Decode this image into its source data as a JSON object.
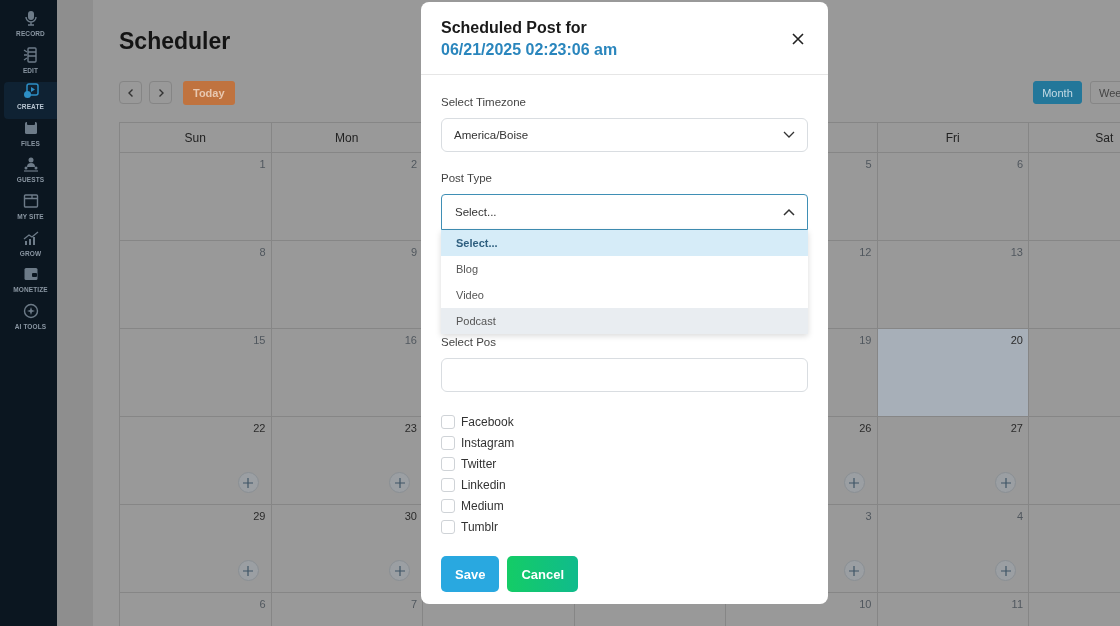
{
  "sidebar": {
    "items": [
      {
        "label": "RECORD",
        "kind": "mic",
        "selected": false
      },
      {
        "label": "EDIT",
        "kind": "film",
        "selected": false
      },
      {
        "label": "CREATE",
        "kind": "play",
        "selected": true
      },
      {
        "label": "FILES",
        "kind": "folder",
        "selected": false
      },
      {
        "label": "GUESTS",
        "kind": "people",
        "selected": false
      },
      {
        "label": "MY SITE",
        "kind": "window",
        "selected": false
      },
      {
        "label": "GROW",
        "kind": "bars",
        "selected": false
      },
      {
        "label": "MONETIZE",
        "kind": "wallet",
        "selected": false
      },
      {
        "label": "AI TOOLS",
        "kind": "ai",
        "selected": false
      }
    ]
  },
  "page": {
    "title": "Scheduler"
  },
  "toolbar": {
    "today": "Today",
    "views": [
      {
        "label": "Month",
        "selected": true
      },
      {
        "label": "Wee",
        "selected": false
      }
    ]
  },
  "calendar": {
    "headers": {
      "sun": "Sun",
      "mon": "Mon",
      "fri": "Fri",
      "sat": "Sat"
    },
    "weeks": [
      {
        "sun": {
          "day": "1",
          "faded": true,
          "today": false,
          "add": false
        },
        "mon": {
          "day": "2",
          "faded": true,
          "today": false,
          "add": false
        },
        "thu": {
          "day": "5",
          "faded": true,
          "today": false,
          "add": false
        },
        "fri": {
          "day": "6",
          "faded": true,
          "today": false,
          "add": false
        }
      },
      {
        "sun": {
          "day": "8",
          "faded": true,
          "today": false,
          "add": false
        },
        "mon": {
          "day": "9",
          "faded": true,
          "today": false,
          "add": false
        },
        "thu": {
          "day": "12",
          "faded": true,
          "today": false,
          "add": false
        },
        "fri": {
          "day": "13",
          "faded": true,
          "today": false,
          "add": false
        }
      },
      {
        "sun": {
          "day": "15",
          "faded": true,
          "today": false,
          "add": false
        },
        "mon": {
          "day": "16",
          "faded": true,
          "today": false,
          "add": false
        },
        "thu": {
          "day": "19",
          "faded": true,
          "today": false,
          "add": false
        },
        "fri": {
          "day": "20",
          "faded": false,
          "today": true,
          "add": false
        }
      },
      {
        "sun": {
          "day": "22",
          "faded": false,
          "today": false,
          "add": true
        },
        "mon": {
          "day": "23",
          "faded": false,
          "today": false,
          "add": true
        },
        "thu": {
          "day": "26",
          "faded": false,
          "today": false,
          "add": true
        },
        "fri": {
          "day": "27",
          "faded": false,
          "today": false,
          "add": true
        }
      },
      {
        "sun": {
          "day": "29",
          "faded": false,
          "today": false,
          "add": true
        },
        "mon": {
          "day": "30",
          "faded": false,
          "today": false,
          "add": true
        },
        "thu": {
          "day": "3",
          "faded": true,
          "today": false,
          "add": true
        },
        "fri": {
          "day": "4",
          "faded": true,
          "today": false,
          "add": true
        }
      },
      {
        "sun": {
          "day": "6",
          "faded": true,
          "today": false,
          "add": false
        },
        "mon": {
          "day": "7",
          "faded": true,
          "today": false,
          "add": false
        },
        "thu": {
          "day": "10",
          "faded": true,
          "today": false,
          "add": false
        },
        "fri": {
          "day": "11",
          "faded": true,
          "today": false,
          "add": false
        }
      }
    ]
  },
  "modal": {
    "title": "Scheduled Post for",
    "datetime": "06/21/2025 02:23:06 am",
    "fields": [
      {
        "kind": "select",
        "label": "Select Timezone",
        "value": "America/Boise",
        "open": false
      },
      {
        "kind": "select",
        "label": "Post Type",
        "placeholder": "Select...",
        "open": true,
        "options": [
          {
            "label": "Select...",
            "selected": true,
            "hovered": false
          },
          {
            "label": "Blog",
            "selected": false,
            "hovered": false
          },
          {
            "label": "Video",
            "selected": false,
            "hovered": false
          },
          {
            "label": "Podcast",
            "selected": false,
            "hovered": true
          }
        ]
      },
      {
        "kind": "text",
        "label": "Select Pos"
      }
    ],
    "checkboxes": [
      {
        "label": "Facebook",
        "checked": false
      },
      {
        "label": "Instagram",
        "checked": false
      },
      {
        "label": "Twitter",
        "checked": false
      },
      {
        "label": "Linkedin",
        "checked": false
      },
      {
        "label": "Medium",
        "checked": false
      },
      {
        "label": "Tumblr",
        "checked": false
      }
    ],
    "buttons": [
      {
        "label": "Save",
        "kind": "primary"
      },
      {
        "label": "Cancel",
        "kind": "secondary"
      }
    ]
  }
}
